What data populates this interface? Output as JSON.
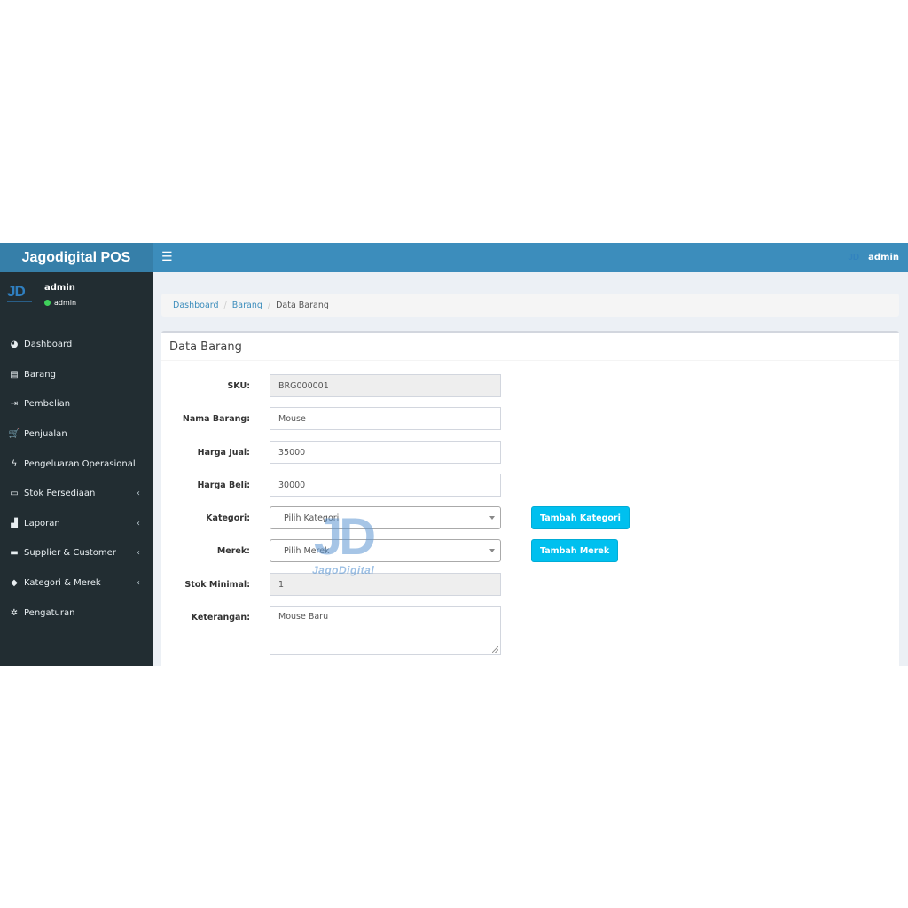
{
  "app": {
    "title": "Jagodigital POS"
  },
  "header": {
    "user_name": "admin",
    "mini_logo": "JD"
  },
  "user_panel": {
    "logo": "JD",
    "name": "admin",
    "status": "admin",
    "status_color": "#3fd15b"
  },
  "sidebar": {
    "items": [
      {
        "label": "Dashboard",
        "icon": "dashboard-icon",
        "glyph": "◕",
        "has_children": false
      },
      {
        "label": "Barang",
        "icon": "table-icon",
        "glyph": "▤",
        "has_children": false
      },
      {
        "label": "Pembelian",
        "icon": "sign-in-icon",
        "glyph": "⇥",
        "has_children": false
      },
      {
        "label": "Penjualan",
        "icon": "cart-icon",
        "glyph": "🛒",
        "has_children": false
      },
      {
        "label": "Pengeluaran Operasional",
        "icon": "bolt-icon",
        "glyph": "ϟ",
        "has_children": false
      },
      {
        "label": "Stok Persediaan",
        "icon": "inbox-icon",
        "glyph": "▭",
        "has_children": true
      },
      {
        "label": "Laporan",
        "icon": "bar-chart-icon",
        "glyph": "▟",
        "has_children": true
      },
      {
        "label": "Supplier & Customer",
        "icon": "folder-icon",
        "glyph": "▬",
        "has_children": true
      },
      {
        "label": "Kategori & Merek",
        "icon": "tag-icon",
        "glyph": "◆",
        "has_children": true
      },
      {
        "label": "Pengaturan",
        "icon": "gear-icon",
        "glyph": "✲",
        "has_children": false
      }
    ],
    "chevron": "‹"
  },
  "breadcrumb": {
    "home": "Dashboard",
    "parent": "Barang",
    "current": "Data Barang",
    "separator": "/"
  },
  "box": {
    "title": "Data Barang"
  },
  "form": {
    "sku": {
      "label": "SKU:",
      "value": "BRG000001"
    },
    "nama": {
      "label": "Nama Barang:",
      "value": "Mouse"
    },
    "harga_jual": {
      "label": "Harga Jual:",
      "value": "35000"
    },
    "harga_beli": {
      "label": "Harga Beli:",
      "value": "30000"
    },
    "kategori": {
      "label": "Kategori:",
      "value": "Pilih Kategori",
      "button": "Tambah Kategori"
    },
    "merek": {
      "label": "Merek:",
      "value": "Pilih Merek",
      "button": "Tambah Merek"
    },
    "stok_minimal": {
      "label": "Stok Minimal:",
      "value": "1"
    },
    "keterangan": {
      "label": "Keterangan:",
      "value": "Mouse Baru"
    }
  },
  "watermark": {
    "logo": "JD",
    "text": "JagoDigital"
  },
  "colors": {
    "header": "#3c8dbc",
    "logo_bar": "#367fa9",
    "sidebar": "#222d32",
    "button_info": "#00c0ef",
    "link": "#3c8dbc"
  }
}
